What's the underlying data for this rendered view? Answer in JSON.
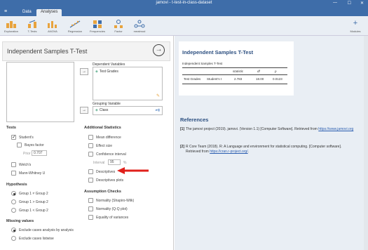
{
  "window": {
    "title": "jamovi - t-test-in-class-dataset",
    "controls": {
      "minimize": "—",
      "maximize": "☐",
      "close": "✕"
    }
  },
  "tabs": [
    {
      "label": "Data"
    },
    {
      "label": "Analyses"
    }
  ],
  "toolbar": {
    "items": [
      {
        "label": "Exploration"
      },
      {
        "label": "T-Tests"
      },
      {
        "label": "ANOVA"
      },
      {
        "label": "Regression"
      },
      {
        "label": "Frequencies"
      },
      {
        "label": "Factor"
      },
      {
        "label": "meatmod"
      }
    ],
    "modules_label": "Modules",
    "modules_icon": "+"
  },
  "options": {
    "title": "Independent Samples T-Test",
    "run_icon": "→",
    "dependent_label": "Dependent Variables",
    "dependent_var": "Test Grades",
    "grouping_label": "Grouping Variable",
    "grouping_var": "Class",
    "move_arrow": "→",
    "tests": {
      "title": "Tests",
      "students": "Student's",
      "bayes": "Bayes factor",
      "prior_label": "Prior",
      "prior_value": "0.707",
      "welchs": "Welch's",
      "mann": "Mann-Whitney U"
    },
    "hypothesis": {
      "title": "Hypothesis",
      "g1": "Group 1 ≠ Group 2",
      "g2": "Group 1 > Group 2",
      "g3": "Group 1 < Group 2"
    },
    "missing": {
      "title": "Missing values",
      "a": "Exclude cases analysis by analysis",
      "b": "Exclude cases listwise"
    },
    "additional": {
      "title": "Additional Statistics",
      "mean_diff": "Mean difference",
      "effect": "Effect size",
      "ci": "Confidence interval",
      "interval_label": "Interval",
      "interval_value": "95",
      "percent": "%",
      "descriptives": "Descriptives",
      "desc_plots": "Descriptives plots"
    },
    "assumption": {
      "title": "Assumption Checks",
      "normality": "Normality (Shapiro-Wilk)",
      "qq": "Normality (Q-Q plot)",
      "equality": "Equality of variances"
    }
  },
  "results": {
    "title": "Independent Samples T-Test",
    "subtitle": "Independent Samples T-Test",
    "headers": [
      "statistic",
      "df",
      "p"
    ],
    "row": {
      "var": "Test Grades",
      "test": "Student's t",
      "statistic": "2.783",
      "df": "18.00",
      "p": "0.0123"
    },
    "references_title": "References",
    "refs": [
      {
        "num": "[1]",
        "text": "The jamovi project (2019). jamovi. (Version 1.1) [Computer Software]. Retrieved from ",
        "link": "https://www.jamovi.org"
      },
      {
        "num": "[2]",
        "text": "R Core Team (2018). R: A Language and environment for statistical computing. [Computer software]. Retrieved from ",
        "link": "https://cran.r-project.org/",
        "tail": "."
      }
    ]
  },
  "colors": {
    "accent": "#3e6da9",
    "arrow": "#e0201b",
    "heading": "#2c4f80"
  }
}
